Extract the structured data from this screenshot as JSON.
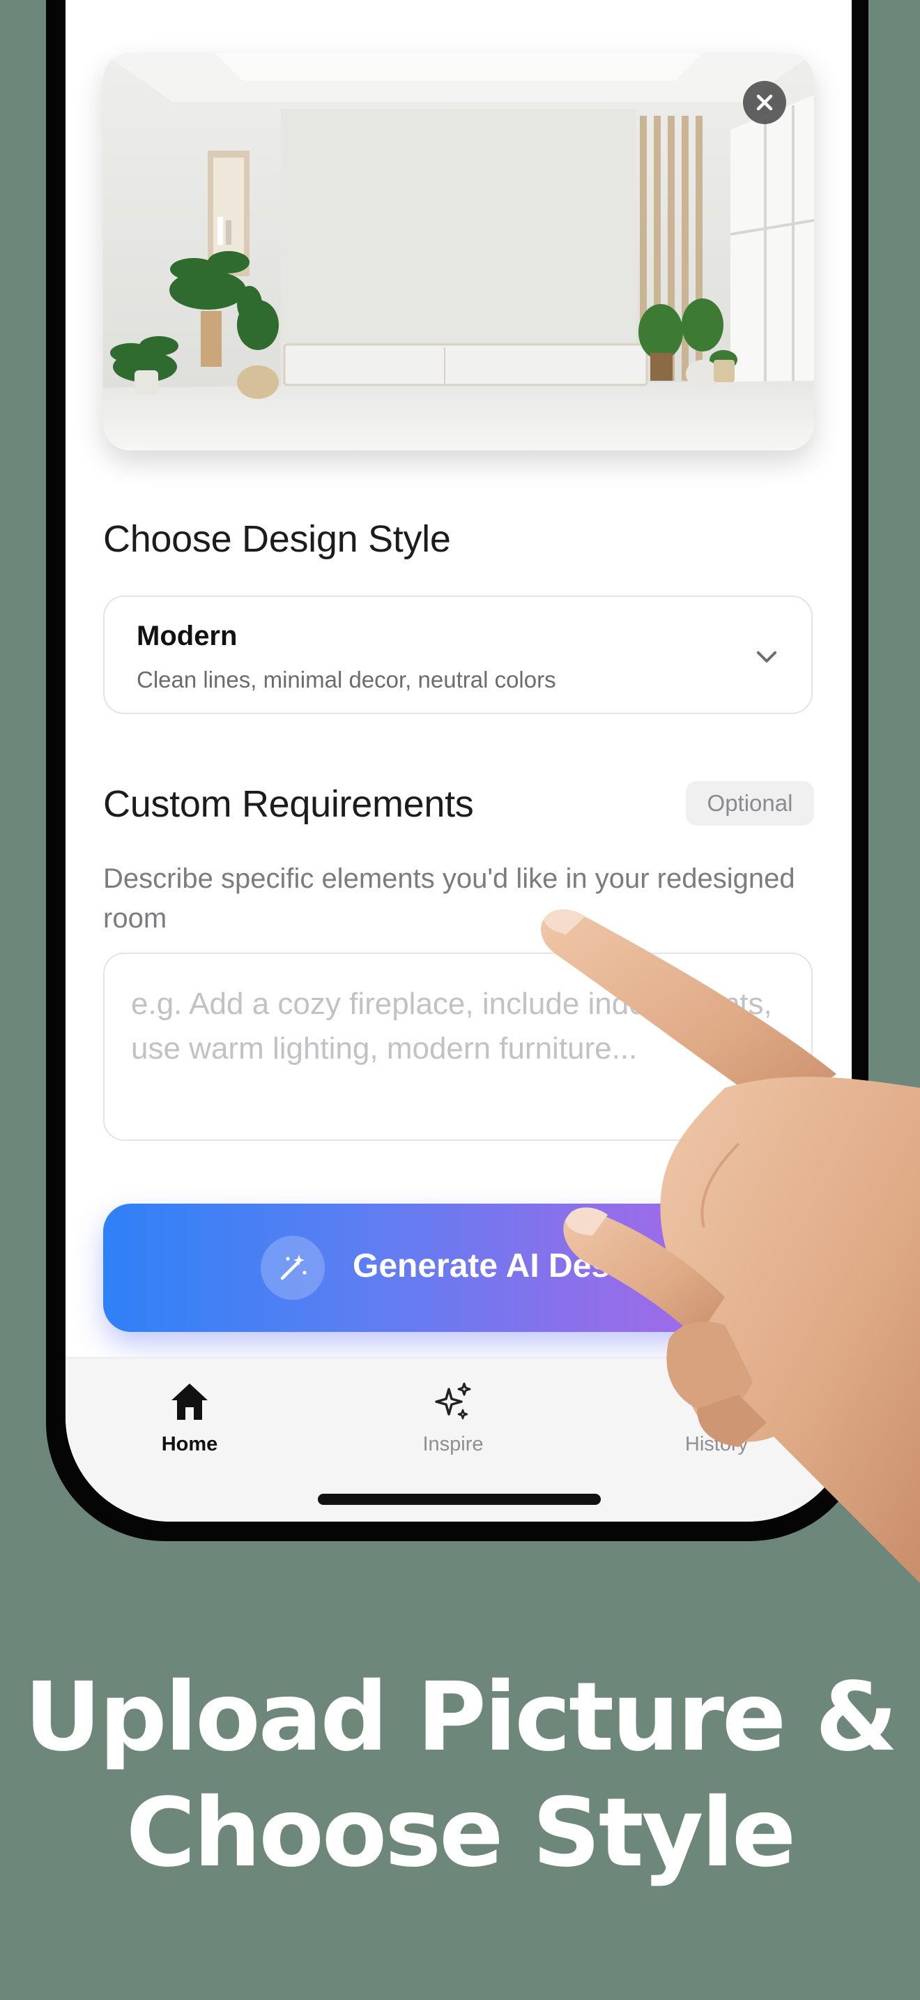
{
  "style_section": {
    "title": "Choose Design Style",
    "selected_style": "Modern",
    "selected_style_description": "Clean lines, minimal decor, neutral colors"
  },
  "requirements_section": {
    "title": "Custom Requirements",
    "badge": "Optional",
    "helper_text": "Describe specific elements you'd like in your redesigned room",
    "placeholder": "e.g. Add a cozy fireplace, include indoor plants, use warm lighting, modern furniture..."
  },
  "generate_button": {
    "label": "Generate AI Design",
    "icon": "magic-wand-icon"
  },
  "tab_bar": {
    "tabs": [
      {
        "label": "Home",
        "icon": "home-icon",
        "active": true
      },
      {
        "label": "Inspire",
        "icon": "sparkles-icon",
        "active": false
      },
      {
        "label": "History",
        "icon": "history-icon",
        "active": false
      }
    ]
  },
  "headline": {
    "line1": "Upload Picture &",
    "line2": "Choose Style"
  },
  "colors": {
    "background": "#6d887a",
    "button_gradient_start": "#2f80f7",
    "button_gradient_end": "#b865e4"
  }
}
